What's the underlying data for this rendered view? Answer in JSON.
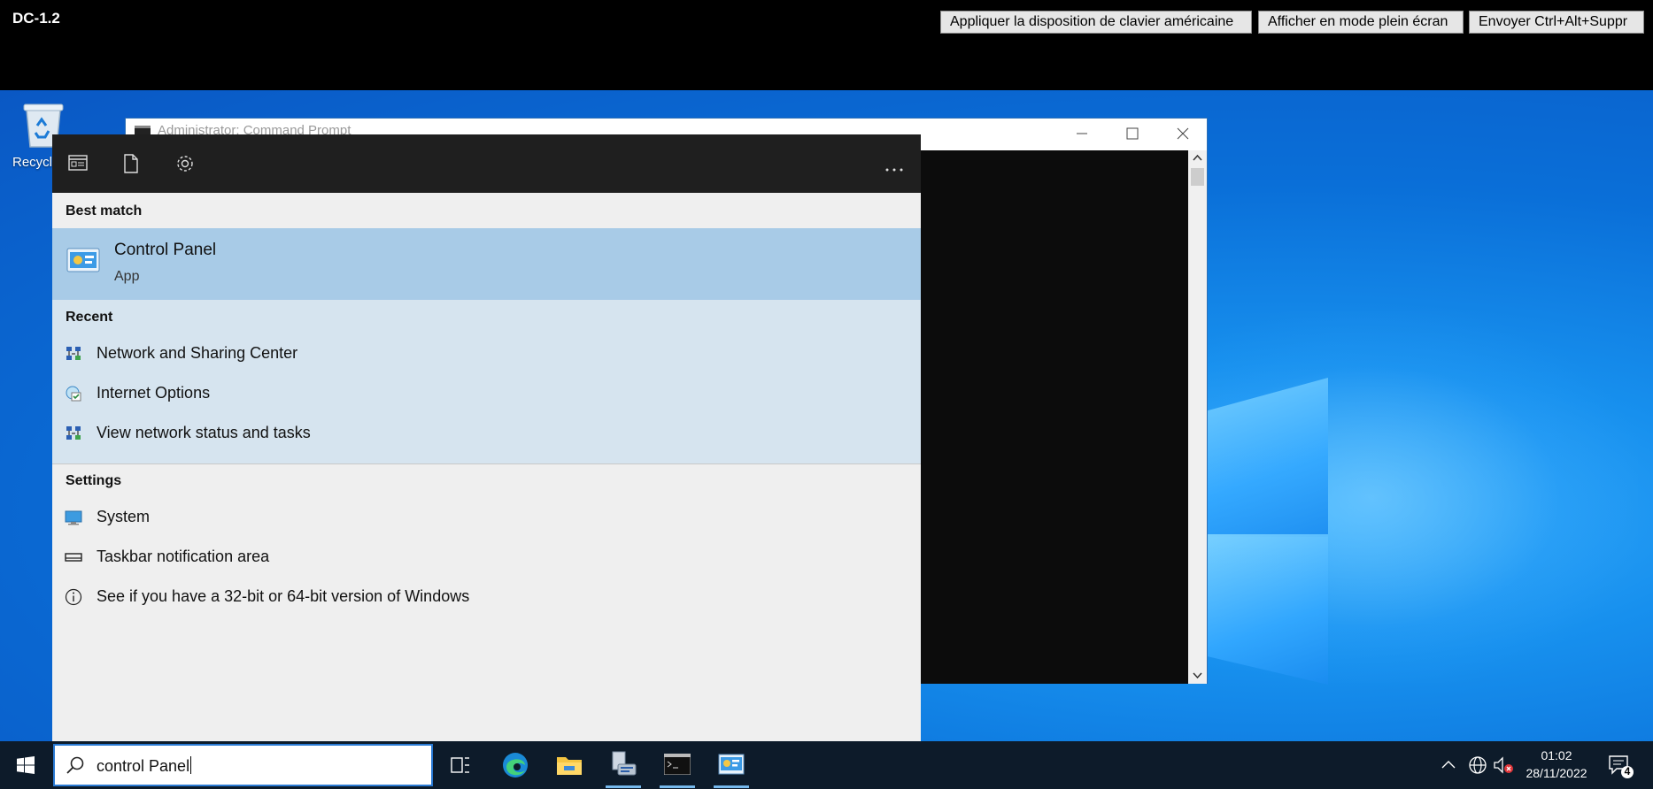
{
  "topbar": {
    "host": "DC-1.2",
    "btn_keyboard": "Appliquer la disposition de clavier américaine",
    "btn_fullscreen": "Afficher en mode plein écran",
    "btn_cad": "Envoyer Ctrl+Alt+Suppr"
  },
  "desktop": {
    "recycle_label": "Recycle"
  },
  "cmd": {
    "title": "Administrator: Command Prompt"
  },
  "start": {
    "best_match_header": "Best match",
    "best": {
      "title": "Control Panel",
      "subtitle": "App",
      "icon": "control-panel-icon"
    },
    "recent_header": "Recent",
    "recent": [
      {
        "label": "Network and Sharing Center",
        "icon": "network-icon"
      },
      {
        "label": "Internet Options",
        "icon": "internet-options-icon"
      },
      {
        "label": "View network status and tasks",
        "icon": "network-icon"
      }
    ],
    "settings_header": "Settings",
    "settings": [
      {
        "label": "System",
        "icon": "monitor-icon"
      },
      {
        "label": "Taskbar notification area",
        "icon": "taskbar-icon"
      },
      {
        "label": "See if you have a 32-bit or 64-bit version of Windows",
        "icon": "info-icon"
      }
    ]
  },
  "taskbar": {
    "search_value": "control Panel",
    "time": "01:02",
    "date": "28/11/2022",
    "notifications": "4"
  }
}
